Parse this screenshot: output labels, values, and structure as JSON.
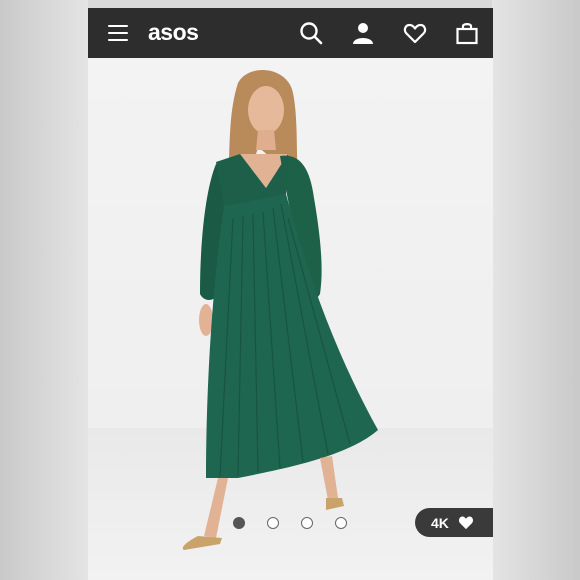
{
  "header": {
    "logo": "asos",
    "icons": [
      "menu-icon",
      "search-icon",
      "account-icon",
      "heart-icon",
      "bag-icon"
    ]
  },
  "product_image": {
    "description_colors": {
      "dress": "#1d5f48",
      "background": "#f1f1f1"
    }
  },
  "carousel": {
    "total": 4,
    "active_index": 0
  },
  "likes_badge": {
    "count": "4K"
  }
}
